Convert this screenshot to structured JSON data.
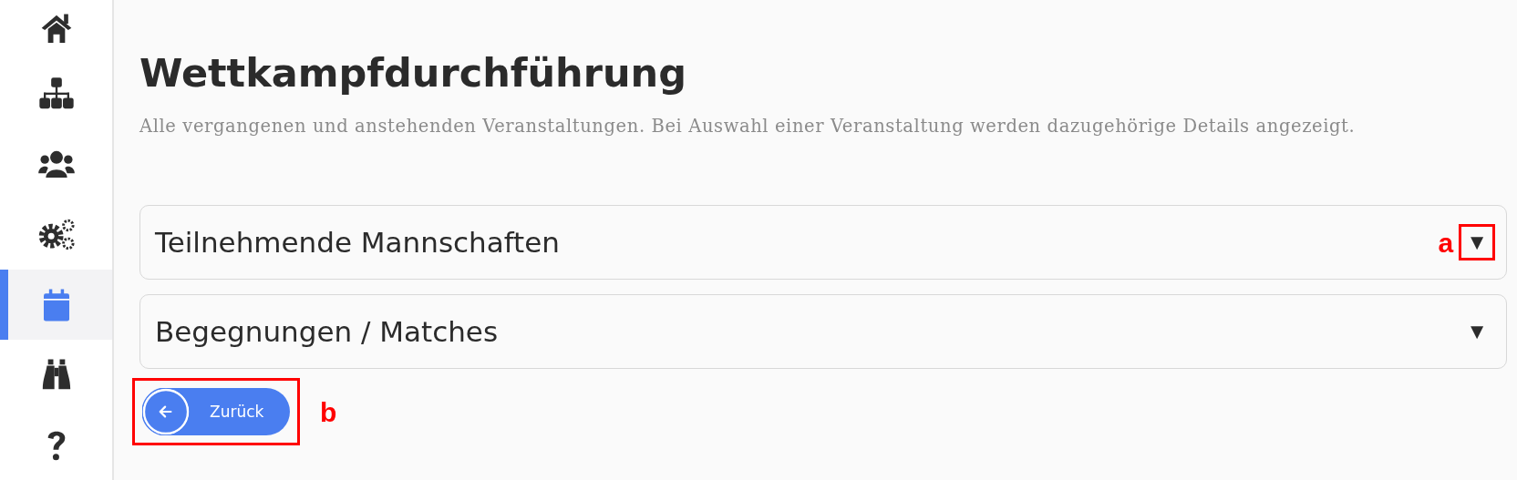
{
  "sidebar": {
    "items": [
      {
        "selected": false
      },
      {
        "selected": false
      },
      {
        "selected": false
      },
      {
        "selected": false
      },
      {
        "selected": true
      },
      {
        "selected": false
      },
      {
        "selected": false
      }
    ]
  },
  "page": {
    "title": "Wettkampfdurchführung",
    "subtitle": "Alle vergangenen und anstehenden Veranstaltungen. Bei Auswahl einer Veranstaltung werden dazugehörige Details angezeigt."
  },
  "accordions": [
    {
      "title": "Teilnehmende Mannschaften",
      "toggle": "▼",
      "annotation": "a"
    },
    {
      "title": "Begegnungen / Matches",
      "toggle": "▼"
    }
  ],
  "back_button": {
    "label": "Zurück",
    "annotation": "b"
  }
}
